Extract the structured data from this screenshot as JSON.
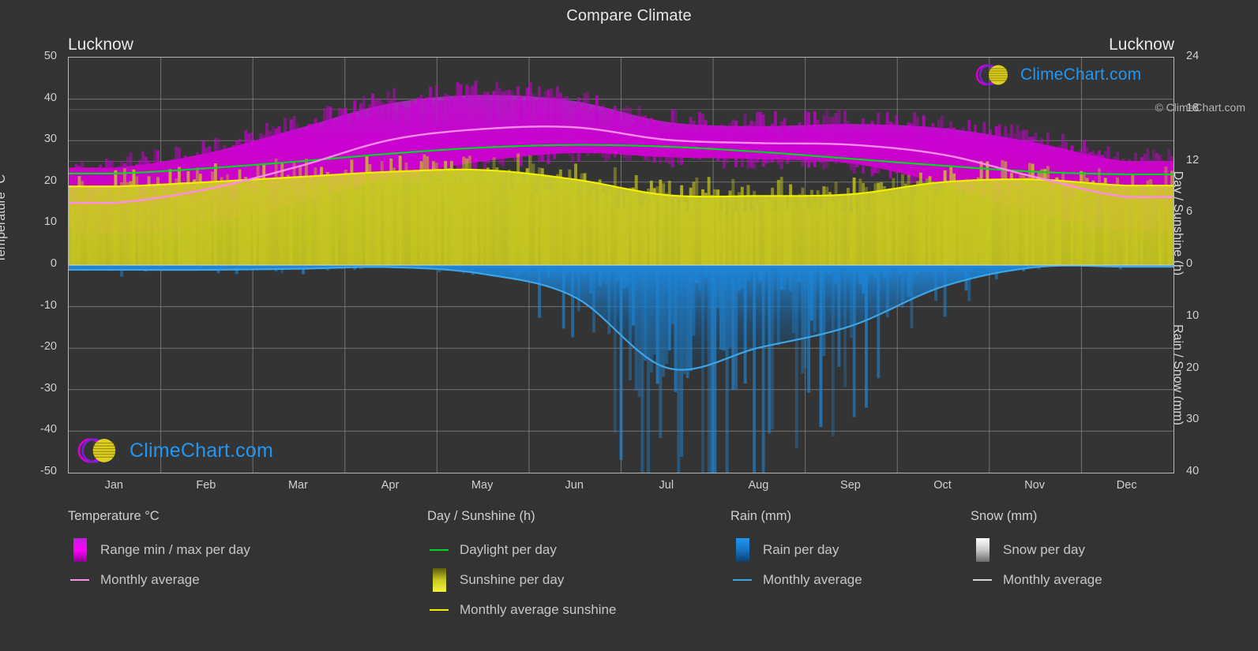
{
  "header": {
    "title": "Compare Climate",
    "left_location": "Lucknow",
    "right_location": "Lucknow"
  },
  "axes": {
    "left_title": "Temperature °C",
    "right_title_top": "Day / Sunshine (h)",
    "right_title_bottom": "Rain / Snow (mm)",
    "left_ticks": [
      "50",
      "40",
      "30",
      "20",
      "10",
      "0",
      "-10",
      "-20",
      "-30",
      "-40",
      "-50"
    ],
    "right_ticks_top": [
      "24",
      "18",
      "12",
      "6",
      "0"
    ],
    "right_ticks_bottom": [
      "0",
      "10",
      "20",
      "30",
      "40"
    ],
    "x_ticks": [
      "Jan",
      "Feb",
      "Mar",
      "Apr",
      "May",
      "Jun",
      "Jul",
      "Aug",
      "Sep",
      "Oct",
      "Nov",
      "Dec"
    ]
  },
  "legend": {
    "columns": [
      {
        "title": "Temperature °C",
        "items": [
          {
            "label": "Range min / max per day",
            "swatch": "gradient-magenta",
            "color": "#e000e0"
          },
          {
            "label": "Monthly average",
            "swatch": "line",
            "color": "#ff8ce8"
          }
        ]
      },
      {
        "title": "Day / Sunshine (h)",
        "items": [
          {
            "label": "Daylight per day",
            "swatch": "line",
            "color": "#00d820"
          },
          {
            "label": "Sunshine per day",
            "swatch": "gradient-yellow",
            "color": "#e8e820"
          },
          {
            "label": "Monthly average sunshine",
            "swatch": "line",
            "color": "#f0f000"
          }
        ]
      },
      {
        "title": "Rain (mm)",
        "items": [
          {
            "label": "Rain per day",
            "swatch": "gradient-blue",
            "color": "#1878d0"
          },
          {
            "label": "Monthly average",
            "swatch": "line",
            "color": "#3ca5e8"
          }
        ]
      },
      {
        "title": "Snow (mm)",
        "items": [
          {
            "label": "Snow per day",
            "swatch": "gradient-white",
            "color": "#e8e8e8"
          },
          {
            "label": "Monthly average",
            "swatch": "line",
            "color": "#d8d8d8"
          }
        ]
      }
    ],
    "copyright": "© ClimeChart.com"
  },
  "watermark": {
    "text": "ClimeChart.com"
  },
  "colors": {
    "background": "#333333",
    "plot_background": "#343434",
    "grid": "#9a9a9a",
    "temp_range": "#d000d0",
    "temp_avg_line": "#ff8ce8",
    "daylight_line": "#00d820",
    "sunshine_fill": "#c8c828",
    "sunshine_line": "#f0f000",
    "rain_fill": "#1878d0",
    "rain_line": "#3ca5e8",
    "text": "#d0d0d0",
    "logo_blue": "#2196f3",
    "logo_magenta": "#d400d4",
    "logo_yellow": "#e8e020"
  },
  "chart_data": {
    "type": "area",
    "title": "Compare Climate",
    "subtitle": "Lucknow",
    "xlabel": "",
    "ylabel": "Temperature °C",
    "grid": true,
    "legend_position": "bottom",
    "x": [
      "Jan",
      "Feb",
      "Mar",
      "Apr",
      "May",
      "Jun",
      "Jul",
      "Aug",
      "Sep",
      "Oct",
      "Nov",
      "Dec"
    ],
    "axis_temperature": {
      "label": "Temperature °C",
      "min": -50,
      "max": 50,
      "step": 10
    },
    "axis_day_sunshine": {
      "label": "Day / Sunshine (h)",
      "min": 0,
      "max": 24,
      "step": 6
    },
    "axis_rain_snow": {
      "label": "Rain / Snow (mm)",
      "min": 0,
      "max": 40,
      "step": 10
    },
    "series": [
      {
        "name": "Monthly average temperature",
        "unit": "°C",
        "axis": "temperature",
        "color": "#ff8ce8",
        "values": [
          15.0,
          18.3,
          23.8,
          30.2,
          32.8,
          33.2,
          30.2,
          29.4,
          29.0,
          26.6,
          21.2,
          16.4
        ]
      },
      {
        "name": "Daily max temperature (range top)",
        "unit": "°C",
        "axis": "temperature",
        "color": "#d000d0",
        "values": [
          23.5,
          27.0,
          33.0,
          39.0,
          41.0,
          39.5,
          34.5,
          33.5,
          34.0,
          33.0,
          29.5,
          25.0
        ]
      },
      {
        "name": "Daily min temperature (range bottom)",
        "unit": "°C",
        "axis": "temperature",
        "color": "#d000d0",
        "values": [
          7.5,
          10.0,
          15.0,
          21.0,
          25.0,
          27.0,
          26.0,
          25.5,
          24.5,
          19.5,
          12.5,
          8.0
        ]
      },
      {
        "name": "Daylight per day",
        "unit": "h",
        "axis": "day_sunshine",
        "color": "#00d820",
        "values": [
          10.6,
          11.2,
          12.0,
          12.9,
          13.6,
          13.9,
          13.7,
          13.1,
          12.3,
          11.5,
          10.8,
          10.5
        ]
      },
      {
        "name": "Monthly average sunshine",
        "unit": "h",
        "axis": "day_sunshine",
        "color": "#f0f000",
        "values": [
          9.1,
          9.6,
          10.2,
          10.8,
          11.0,
          9.9,
          8.1,
          8.0,
          8.2,
          9.6,
          9.9,
          9.2
        ]
      },
      {
        "name": "Rain monthly average",
        "unit": "mm",
        "axis": "rain_snow",
        "color": "#3ca5e8",
        "values": [
          0.9,
          0.9,
          0.7,
          0.4,
          1.7,
          6.2,
          19.8,
          15.9,
          11.7,
          4.1,
          0.4,
          0.3
        ]
      },
      {
        "name": "Snow monthly average",
        "unit": "mm",
        "axis": "rain_snow",
        "color": "#d8d8d8",
        "values": [
          0,
          0,
          0,
          0,
          0,
          0,
          0,
          0,
          0,
          0,
          0,
          0
        ]
      }
    ]
  }
}
